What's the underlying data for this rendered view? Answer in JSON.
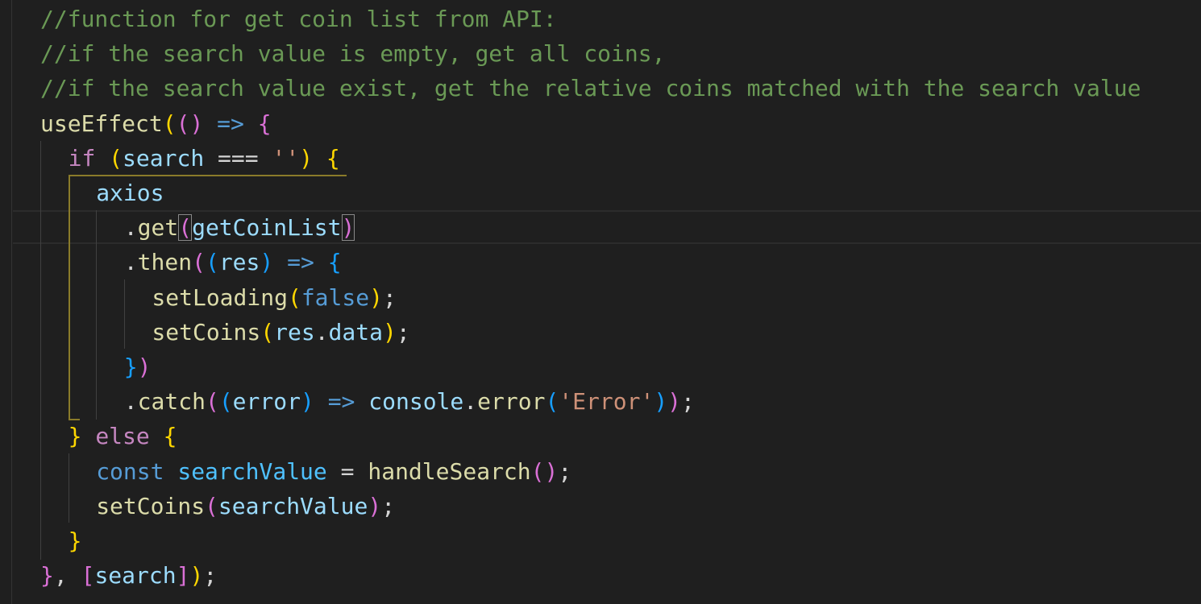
{
  "editor": {
    "lines": [
      {
        "indent": 0,
        "tokens": [
          {
            "t": "//function for get coin list from API:",
            "c": "c"
          }
        ]
      },
      {
        "indent": 0,
        "tokens": [
          {
            "t": "//if the search value is empty, get all coins,",
            "c": "c"
          }
        ]
      },
      {
        "indent": 0,
        "tokens": [
          {
            "t": "//if the search value exist, get the relative coins matched with the search value",
            "c": "c"
          }
        ]
      },
      {
        "indent": 0,
        "tokens": [
          {
            "t": "useEffect",
            "c": "f"
          },
          {
            "t": "(",
            "c": "b1"
          },
          {
            "t": "(",
            "c": "b2"
          },
          {
            "t": ")",
            "c": "b2"
          },
          {
            "t": " ",
            "c": "p"
          },
          {
            "t": "=>",
            "c": "s"
          },
          {
            "t": " ",
            "c": "p"
          },
          {
            "t": "{",
            "c": "b2"
          }
        ]
      },
      {
        "indent": 1,
        "tokens": [
          {
            "t": "if",
            "c": "k"
          },
          {
            "t": " ",
            "c": "p"
          },
          {
            "t": "(",
            "c": "b1"
          },
          {
            "t": "search",
            "c": "v"
          },
          {
            "t": " === ",
            "c": "p"
          },
          {
            "t": "''",
            "c": "str"
          },
          {
            "t": ")",
            "c": "b1"
          },
          {
            "t": " ",
            "c": "p"
          },
          {
            "t": "{",
            "c": "b1"
          }
        ]
      },
      {
        "indent": 2,
        "tokens": [
          {
            "t": "axios",
            "c": "v"
          }
        ]
      },
      {
        "indent": 3,
        "tokens": [
          {
            "t": ".",
            "c": "p"
          },
          {
            "t": "get",
            "c": "f"
          },
          {
            "t": "(",
            "c": "b2",
            "box": true
          },
          {
            "t": "getCoinList",
            "c": "v"
          },
          {
            "t": ")",
            "c": "b2",
            "box": true
          }
        ]
      },
      {
        "indent": 3,
        "tokens": [
          {
            "t": ".",
            "c": "p"
          },
          {
            "t": "then",
            "c": "f"
          },
          {
            "t": "(",
            "c": "b2"
          },
          {
            "t": "(",
            "c": "b3"
          },
          {
            "t": "res",
            "c": "v"
          },
          {
            "t": ")",
            "c": "b3"
          },
          {
            "t": " ",
            "c": "p"
          },
          {
            "t": "=>",
            "c": "s"
          },
          {
            "t": " ",
            "c": "p"
          },
          {
            "t": "{",
            "c": "b3"
          }
        ]
      },
      {
        "indent": 4,
        "tokens": [
          {
            "t": "setLoading",
            "c": "f"
          },
          {
            "t": "(",
            "c": "b1"
          },
          {
            "t": "false",
            "c": "s"
          },
          {
            "t": ")",
            "c": "b1"
          },
          {
            "t": ";",
            "c": "p"
          }
        ]
      },
      {
        "indent": 4,
        "tokens": [
          {
            "t": "setCoins",
            "c": "f"
          },
          {
            "t": "(",
            "c": "b1"
          },
          {
            "t": "res",
            "c": "v"
          },
          {
            "t": ".",
            "c": "p"
          },
          {
            "t": "data",
            "c": "v"
          },
          {
            "t": ")",
            "c": "b1"
          },
          {
            "t": ";",
            "c": "p"
          }
        ]
      },
      {
        "indent": 3,
        "tokens": [
          {
            "t": "}",
            "c": "b3"
          },
          {
            "t": ")",
            "c": "b2"
          }
        ]
      },
      {
        "indent": 3,
        "tokens": [
          {
            "t": ".",
            "c": "p"
          },
          {
            "t": "catch",
            "c": "f"
          },
          {
            "t": "(",
            "c": "b2"
          },
          {
            "t": "(",
            "c": "b3"
          },
          {
            "t": "error",
            "c": "v"
          },
          {
            "t": ")",
            "c": "b3"
          },
          {
            "t": " ",
            "c": "p"
          },
          {
            "t": "=>",
            "c": "s"
          },
          {
            "t": " ",
            "c": "p"
          },
          {
            "t": "console",
            "c": "v"
          },
          {
            "t": ".",
            "c": "p"
          },
          {
            "t": "error",
            "c": "f"
          },
          {
            "t": "(",
            "c": "b3"
          },
          {
            "t": "'Error'",
            "c": "str"
          },
          {
            "t": ")",
            "c": "b3"
          },
          {
            "t": ")",
            "c": "b2"
          },
          {
            "t": ";",
            "c": "p"
          }
        ]
      },
      {
        "indent": 1,
        "tokens": [
          {
            "t": "}",
            "c": "b1"
          },
          {
            "t": " ",
            "c": "p"
          },
          {
            "t": "else",
            "c": "k"
          },
          {
            "t": " ",
            "c": "p"
          },
          {
            "t": "{",
            "c": "b1"
          }
        ]
      },
      {
        "indent": 2,
        "tokens": [
          {
            "t": "const",
            "c": "s"
          },
          {
            "t": " ",
            "c": "p"
          },
          {
            "t": "searchValue",
            "c": "n"
          },
          {
            "t": " = ",
            "c": "p"
          },
          {
            "t": "handleSearch",
            "c": "f"
          },
          {
            "t": "(",
            "c": "b2"
          },
          {
            "t": ")",
            "c": "b2"
          },
          {
            "t": ";",
            "c": "p"
          }
        ]
      },
      {
        "indent": 2,
        "tokens": [
          {
            "t": "setCoins",
            "c": "f"
          },
          {
            "t": "(",
            "c": "b2"
          },
          {
            "t": "searchValue",
            "c": "v"
          },
          {
            "t": ")",
            "c": "b2"
          },
          {
            "t": ";",
            "c": "p"
          }
        ]
      },
      {
        "indent": 1,
        "tokens": [
          {
            "t": "}",
            "c": "b1"
          }
        ]
      },
      {
        "indent": 0,
        "tokens": [
          {
            "t": "}",
            "c": "b2"
          },
          {
            "t": ", ",
            "c": "p"
          },
          {
            "t": "[",
            "c": "b2"
          },
          {
            "t": "search",
            "c": "v"
          },
          {
            "t": "]",
            "c": "b2"
          },
          {
            "t": ")",
            "c": "b1"
          },
          {
            "t": ";",
            "c": "p"
          }
        ]
      }
    ]
  }
}
